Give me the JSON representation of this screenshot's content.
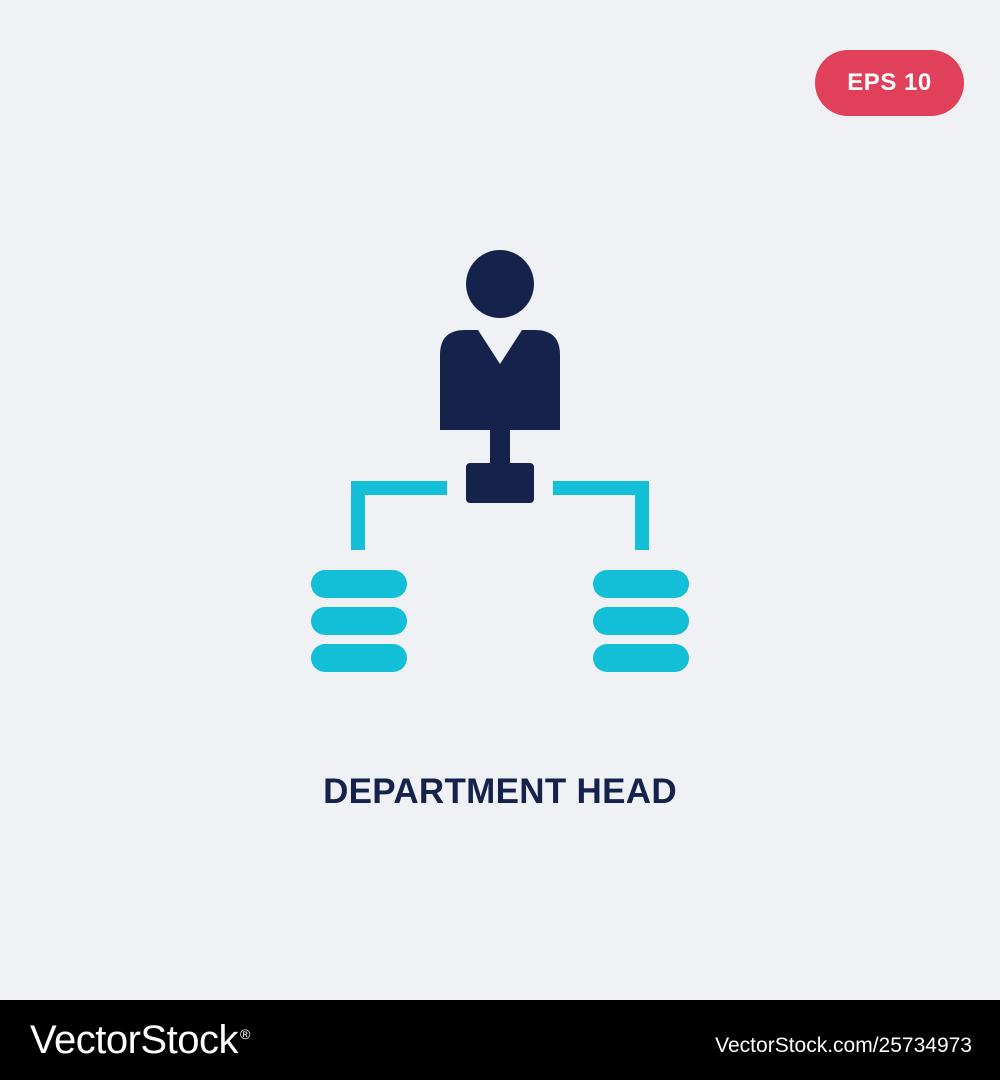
{
  "badge": {
    "label": "EPS 10"
  },
  "icon": {
    "name": "department-head-icon",
    "primary_color": "#15224c",
    "accent_color": "#12bfd6"
  },
  "caption": {
    "text": "DEPARTMENT HEAD"
  },
  "footer": {
    "brand": "VectorStock",
    "brand_mark": "®",
    "image_id": "VectorStock.com/25734973"
  },
  "colors": {
    "background": "#f0f1f4",
    "badge": "#e0405a",
    "footer": "#000000"
  }
}
